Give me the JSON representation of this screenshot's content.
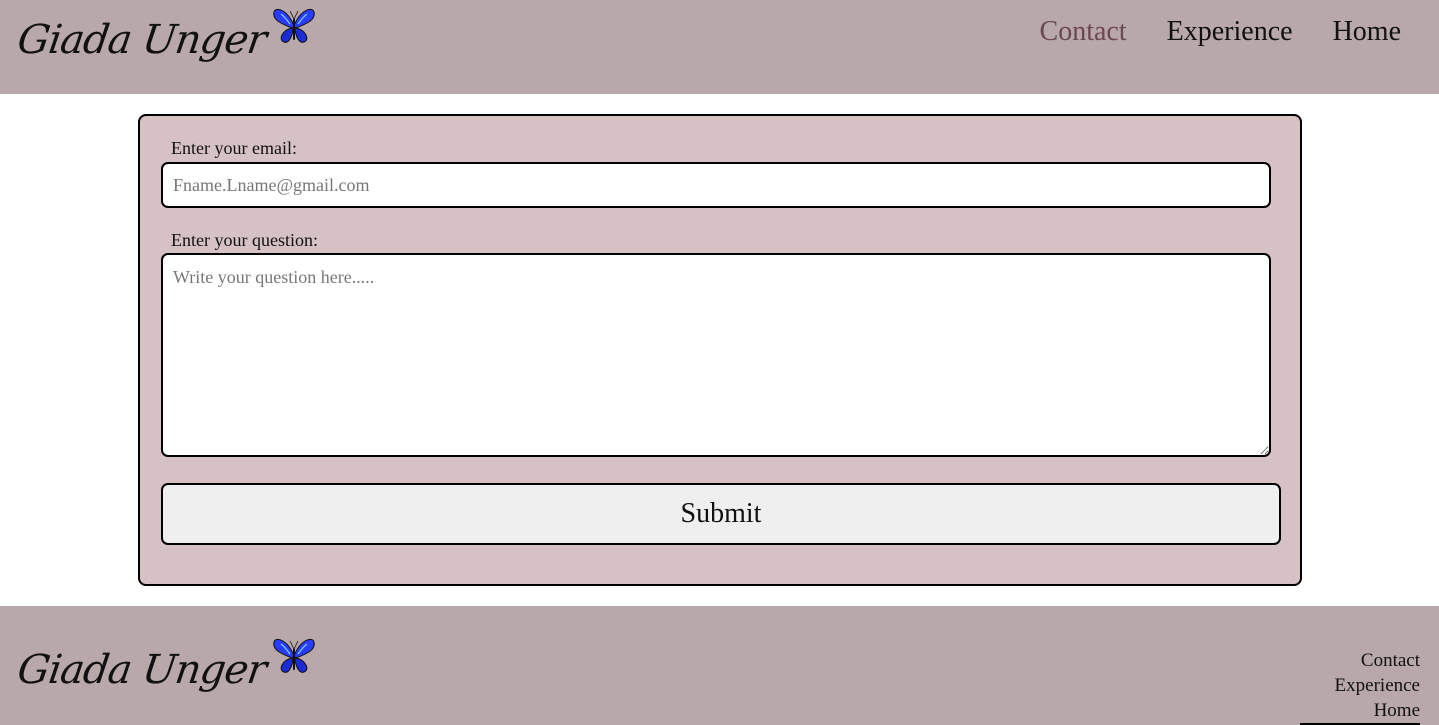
{
  "header": {
    "logo_text": "Giada Unger",
    "logo_icon": "butterfly-icon",
    "nav": [
      {
        "label": "Contact",
        "active": true
      },
      {
        "label": "Experience",
        "active": false
      },
      {
        "label": "Home",
        "active": false
      }
    ]
  },
  "form": {
    "email_label": "Enter your email:",
    "email_value": "",
    "email_placeholder": "Fname.Lname@gmail.com",
    "question_label": "Enter your question:",
    "question_value": "",
    "question_placeholder": "Write your question here.....",
    "submit_label": "Submit"
  },
  "footer": {
    "logo_text": "Giada Unger",
    "logo_icon": "butterfly-icon",
    "links": [
      "Contact",
      "Experience",
      "Home"
    ]
  },
  "colors": {
    "header_bg": "#b8a8aa",
    "card_bg": "#d6c1c4",
    "active_nav": "#6b4750",
    "button_bg": "#efefef",
    "butterfly_blue": "#2a3cff"
  }
}
